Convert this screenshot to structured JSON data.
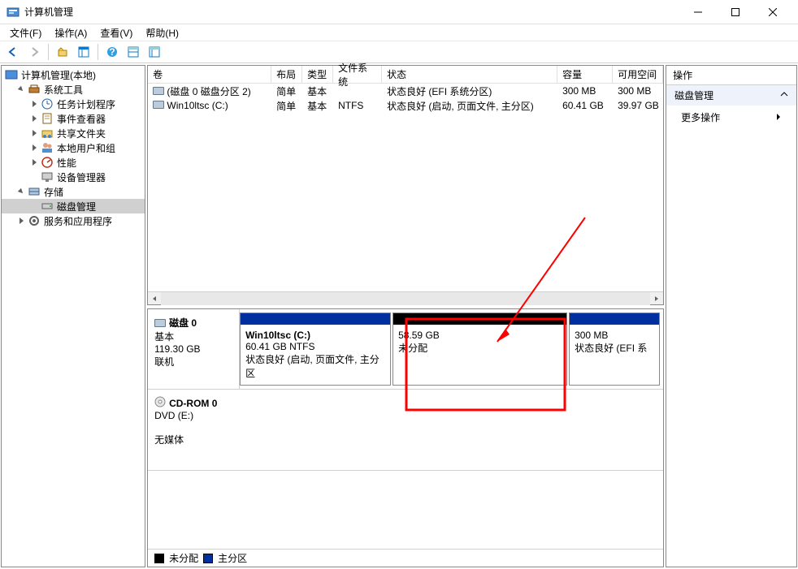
{
  "window": {
    "title": "计算机管理"
  },
  "menus": {
    "file": "文件(F)",
    "action": "操作(A)",
    "view": "查看(V)",
    "help": "帮助(H)"
  },
  "tree": {
    "root": "计算机管理(本地)",
    "systools": "系统工具",
    "tasksched": "任务计划程序",
    "eventv": "事件查看器",
    "shared": "共享文件夹",
    "localusers": "本地用户和组",
    "perf": "性能",
    "devmgr": "设备管理器",
    "storage": "存储",
    "diskmgmt": "磁盘管理",
    "services": "服务和应用程序"
  },
  "columns": {
    "volume": "卷",
    "layout": "布局",
    "type": "类型",
    "fs": "文件系统",
    "status": "状态",
    "capacity": "容量",
    "free": "可用空间"
  },
  "volumes": [
    {
      "name": "(磁盘 0 磁盘分区 2)",
      "layout": "简单",
      "type": "基本",
      "fs": "",
      "status": "状态良好 (EFI 系统分区)",
      "capacity": "300 MB",
      "free": "300 MB"
    },
    {
      "name": "Win10ltsc (C:)",
      "layout": "简单",
      "type": "基本",
      "fs": "NTFS",
      "status": "状态良好 (启动, 页面文件, 主分区)",
      "capacity": "60.41 GB",
      "free": "39.97 GB"
    }
  ],
  "disk0": {
    "name": "磁盘 0",
    "type": "基本",
    "size": "119.30 GB",
    "state": "联机",
    "parts": [
      {
        "title": "Win10ltsc  (C:)",
        "line2": "60.41 GB NTFS",
        "line3": "状态良好 (启动, 页面文件, 主分区"
      },
      {
        "title": "",
        "line2": "58.59 GB",
        "line3": "未分配"
      },
      {
        "title": "",
        "line2": "300 MB",
        "line3": "状态良好 (EFI 系"
      }
    ]
  },
  "cdrom": {
    "name": "CD-ROM 0",
    "line2": "DVD (E:)",
    "state": "无媒体"
  },
  "legend": {
    "unalloc": "未分配",
    "primary": "主分区"
  },
  "actions": {
    "header": "操作",
    "group": "磁盘管理",
    "more": "更多操作"
  }
}
